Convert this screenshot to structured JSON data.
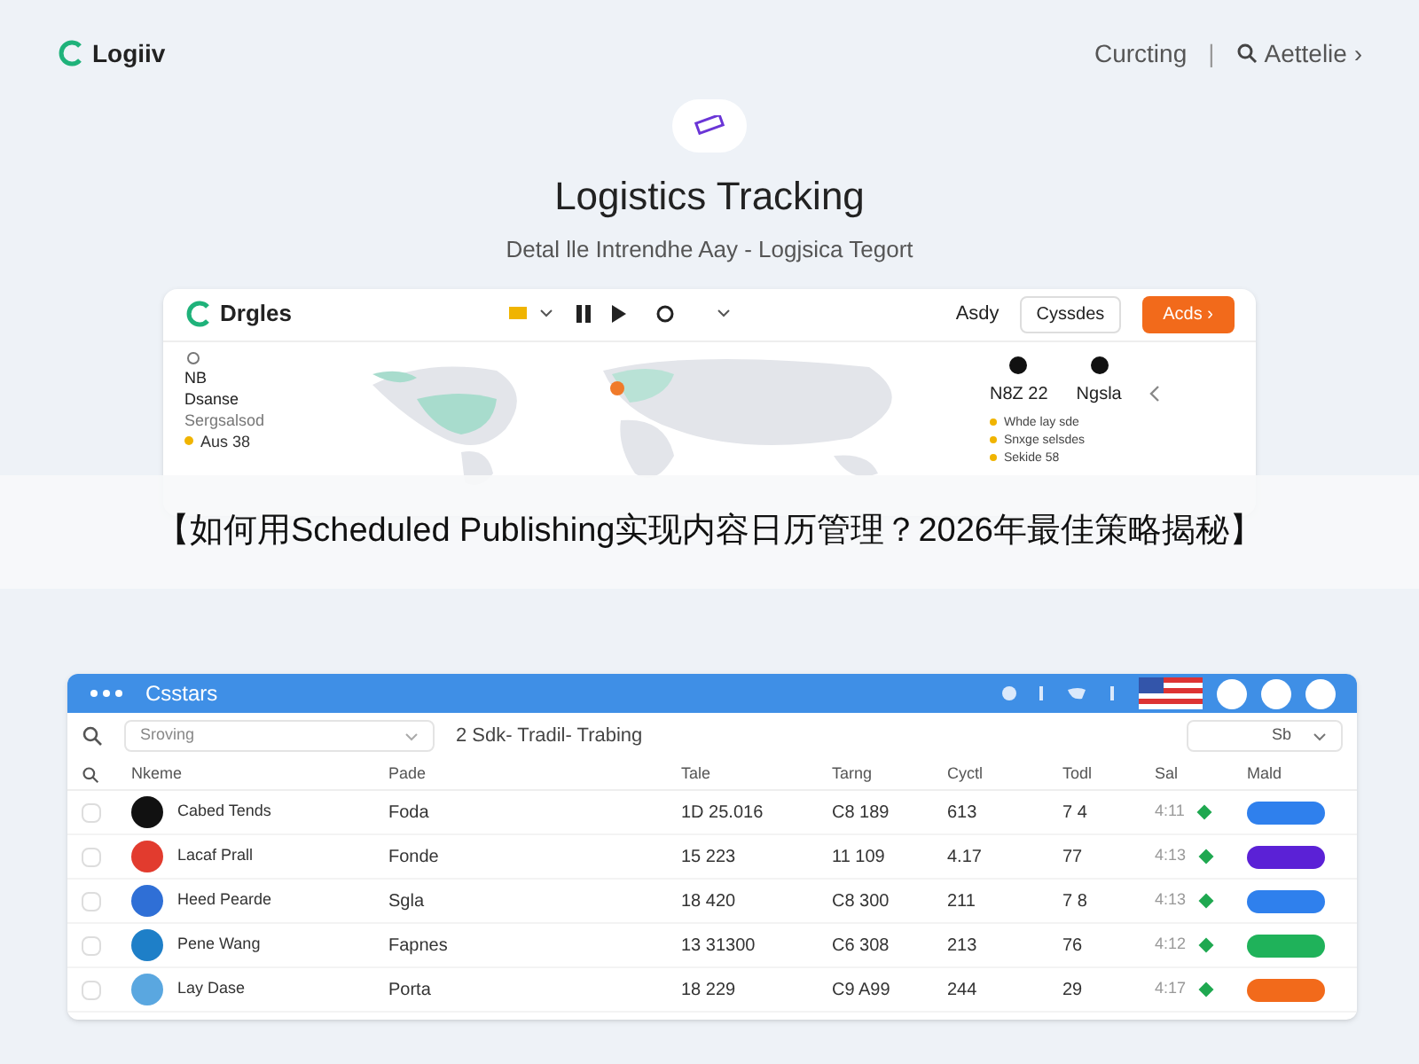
{
  "nav": {
    "brand": "Logiiv",
    "link": "Curcting",
    "separator": "|",
    "account": "Aettelie ›"
  },
  "hero": {
    "title": "Logistics Tracking",
    "subtitle": "Detal lle Intrendhe Aay - Logjsica Tegort"
  },
  "dashboard": {
    "brand": "Drgles",
    "action_label": "Asdy",
    "button": "Cyssdes",
    "primary_button": "Acds ›",
    "left_panel": {
      "title": "NB",
      "subtitle": "Dsanse",
      "detail": "Sergsalsod",
      "tag": "Aus 38"
    },
    "stats": [
      {
        "value": "N8Z 22"
      },
      {
        "value": "Ngsla"
      }
    ],
    "legend": [
      {
        "label": "Whde lay sde"
      },
      {
        "label": "Snxge selsdes"
      },
      {
        "label": "Sekide 58"
      }
    ]
  },
  "banner": "【如何用Scheduled Publishing实现内容日历管理？2026年最佳策略揭秘】",
  "table": {
    "title": "Csstars",
    "filter": {
      "placeholder": "Sroving"
    },
    "breadcrumb": "2 Sdk- Tradil- Trabing",
    "view_label": "Sb",
    "columns": [
      "Nkeme",
      "Pade",
      "Tale",
      "Tarng",
      "Cyctl",
      "Todl",
      "Sal",
      "Mald"
    ],
    "rows": [
      {
        "cells": [
          "Cabed Tends",
          "Foda",
          "1D 25.016",
          "C8 189",
          "613",
          "7 4",
          "4:11"
        ],
        "checked": false,
        "color": "#2f80ed"
      },
      {
        "cells": [
          "Lacaf Prall",
          "Fonde",
          "15 223",
          "11 109",
          "4.17",
          "77",
          "4:13"
        ],
        "checked": false,
        "color": "#5b21d6"
      },
      {
        "cells": [
          "Heed Pearde",
          "Sgla",
          "18 420",
          "C8 300",
          "211",
          "7 8",
          "4:13"
        ],
        "checked": false,
        "color": "#2f80ed"
      },
      {
        "cells": [
          "Pene Wang",
          "Fapnes",
          "13 31300",
          "C6 308",
          "213",
          "76",
          "4:12"
        ],
        "checked": false,
        "color": "#1fb25a"
      },
      {
        "cells": [
          "Lay Dase",
          "Porta",
          "18 229",
          "C9 A99",
          "244",
          "29",
          "4:17"
        ],
        "checked": false,
        "color": "#f26a1b"
      }
    ]
  }
}
